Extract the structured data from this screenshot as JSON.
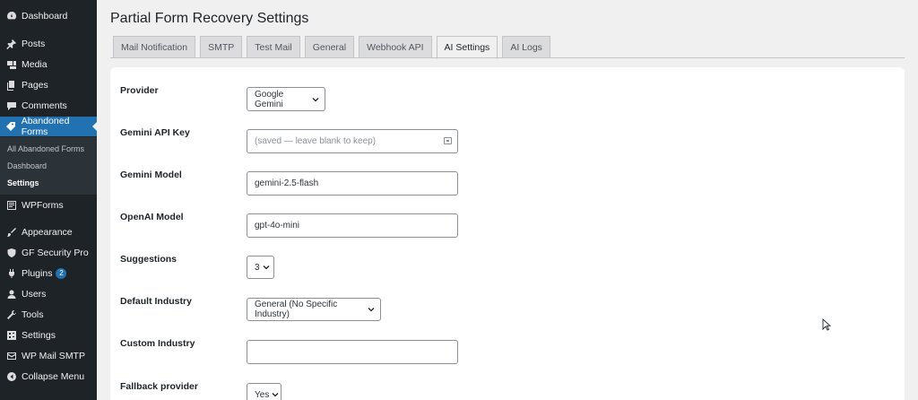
{
  "sidebar": {
    "items": [
      {
        "label": "Dashboard",
        "icon": "dashboard-icon"
      },
      {
        "label": "Posts",
        "icon": "pin-icon"
      },
      {
        "label": "Media",
        "icon": "media-icon"
      },
      {
        "label": "Pages",
        "icon": "pages-icon"
      },
      {
        "label": "Comments",
        "icon": "comment-icon"
      },
      {
        "label": "Abandoned Forms",
        "icon": "tag-icon"
      },
      {
        "label": "WPForms",
        "icon": "forms-icon"
      },
      {
        "label": "Appearance",
        "icon": "brush-icon"
      },
      {
        "label": "GF Security Pro",
        "icon": "shield-icon"
      },
      {
        "label": "Plugins",
        "icon": "plug-icon",
        "badge": "2"
      },
      {
        "label": "Users",
        "icon": "user-icon"
      },
      {
        "label": "Tools",
        "icon": "wrench-icon"
      },
      {
        "label": "Settings",
        "icon": "settings-icon"
      },
      {
        "label": "WP Mail SMTP",
        "icon": "mail-icon"
      },
      {
        "label": "Collapse Menu",
        "icon": "collapse-icon"
      }
    ],
    "submenu": [
      "All Abandoned Forms",
      "Dashboard",
      "Settings"
    ]
  },
  "page": {
    "title": "Partial Form Recovery Settings"
  },
  "tabs": [
    "Mail Notification",
    "SMTP",
    "Test Mail",
    "General",
    "Webhook API",
    "AI Settings",
    "AI Logs"
  ],
  "active_tab": "AI Settings",
  "form": {
    "provider": {
      "label": "Provider",
      "value": "Google Gemini"
    },
    "gemini_key": {
      "label": "Gemini API Key",
      "placeholder": "(saved — leave blank to keep)"
    },
    "gemini_model": {
      "label": "Gemini Model",
      "value": "gemini-2.5-flash"
    },
    "openai_model": {
      "label": "OpenAI Model",
      "value": "gpt-4o-mini"
    },
    "suggestions": {
      "label": "Suggestions",
      "value": "3"
    },
    "default_industry": {
      "label": "Default Industry",
      "value": "General (No Specific Industry)"
    },
    "custom_industry": {
      "label": "Custom Industry",
      "value": ""
    },
    "fallback": {
      "label": "Fallback provider",
      "value": "Yes"
    }
  },
  "colors": {
    "accent": "#2271b1",
    "sidebar_bg": "#1d2327",
    "page_bg": "#f0f0f1"
  }
}
